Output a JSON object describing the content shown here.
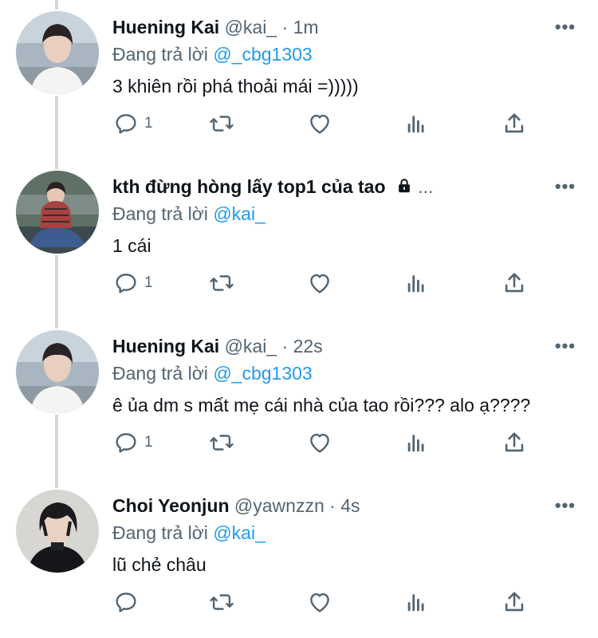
{
  "tweets": [
    {
      "name": "Huening Kai",
      "handle": "@kai_",
      "sep": "·",
      "time": "1m",
      "reply_prefix": "Đang trả lời",
      "reply_to": "@_cbg1303",
      "text": "3 khiên rồi phá thoải mái =)))))",
      "reply_count": "1",
      "more": "•••"
    },
    {
      "name": "kth đừng hòng lấy top1 của tao",
      "handle": "",
      "sep": "",
      "time": "",
      "ellipsis": "...",
      "reply_prefix": "Đang trả lời",
      "reply_to": "@kai_",
      "text": "1 cái",
      "reply_count": "1",
      "more": "•••"
    },
    {
      "name": "Huening Kai",
      "handle": "@kai_",
      "sep": "·",
      "time": "22s",
      "reply_prefix": "Đang trả lời",
      "reply_to": "@_cbg1303",
      "text": "ê ủa dm s mất mẹ cái nhà của tao rồi??? alo ạ????",
      "reply_count": "1",
      "more": "•••"
    },
    {
      "name": "Choi Yeonjun",
      "handle": "@yawnzzn",
      "sep": "·",
      "time": "4s",
      "reply_prefix": "Đang trả lời",
      "reply_to": "@kai_",
      "text": "lũ chẻ châu",
      "reply_count": "",
      "more": "•••"
    }
  ],
  "colors": {
    "text": "#0f1419",
    "secondary": "#536471",
    "link": "#1d9bf0",
    "thread_line": "#cfd9de"
  },
  "icons": [
    "reply-icon",
    "retweet-icon",
    "like-icon",
    "analytics-icon",
    "share-icon",
    "lock-icon",
    "more-icon"
  ]
}
